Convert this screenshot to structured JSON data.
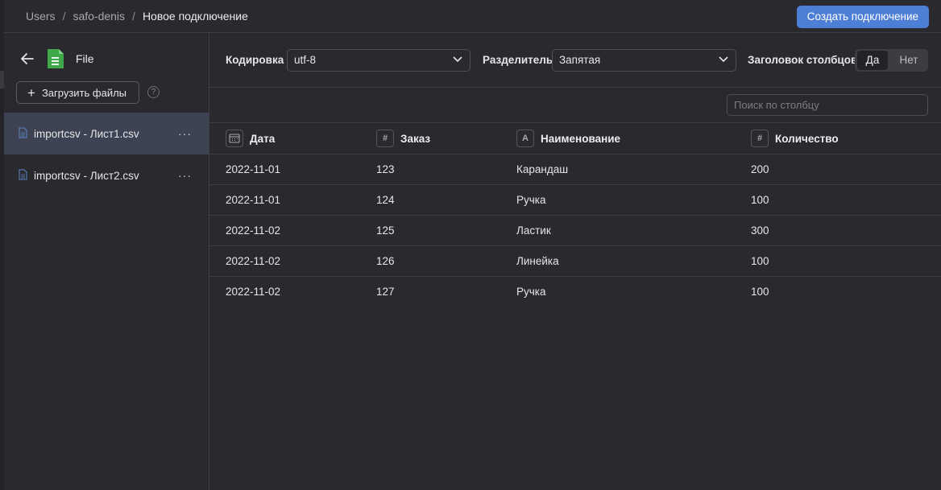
{
  "breadcrumb": {
    "items": [
      "Users",
      "safo-denis",
      "Новое подключение"
    ],
    "separator": "/"
  },
  "header": {
    "create_button": "Создать подключение"
  },
  "sidebar": {
    "title": "File",
    "upload_button": "Загрузить файлы",
    "help": "?",
    "files": [
      {
        "name": "importcsv - Лист1.csv",
        "selected": true
      },
      {
        "name": "importcsv - Лист2.csv",
        "selected": false
      }
    ],
    "more": "···"
  },
  "settings": {
    "encoding_label": "Кодировка",
    "encoding_value": "utf-8",
    "delimiter_label": "Разделитель",
    "delimiter_value": "Запятая",
    "header_label": "Заголовок столбцов",
    "header_options": [
      "Да",
      "Нет"
    ],
    "header_selected": "Да"
  },
  "search": {
    "placeholder": "Поиск по столбцу"
  },
  "table": {
    "columns": [
      {
        "name": "Дата",
        "type": "date",
        "icon": "calendar-icon"
      },
      {
        "name": "Заказ",
        "type": "number",
        "icon": "hash-icon",
        "glyph": "#"
      },
      {
        "name": "Наименование",
        "type": "string",
        "icon": "text-type-icon",
        "glyph": "A"
      },
      {
        "name": "Количество",
        "type": "number",
        "icon": "hash-icon",
        "glyph": "#"
      }
    ],
    "rows": [
      [
        "2022-11-01",
        "123",
        "Карандаш",
        "200"
      ],
      [
        "2022-11-01",
        "124",
        "Ручка",
        "100"
      ],
      [
        "2022-11-02",
        "125",
        "Ластик",
        "300"
      ],
      [
        "2022-11-02",
        "126",
        "Линейка",
        "100"
      ],
      [
        "2022-11-02",
        "127",
        "Ручка",
        "100"
      ]
    ]
  },
  "colors": {
    "background": "#2a292e",
    "accent": "#4e7fd6",
    "selected_row": "#3e4353",
    "file_icon_green": "#3fa84a",
    "doc_icon_blue": "#5f86c9"
  }
}
